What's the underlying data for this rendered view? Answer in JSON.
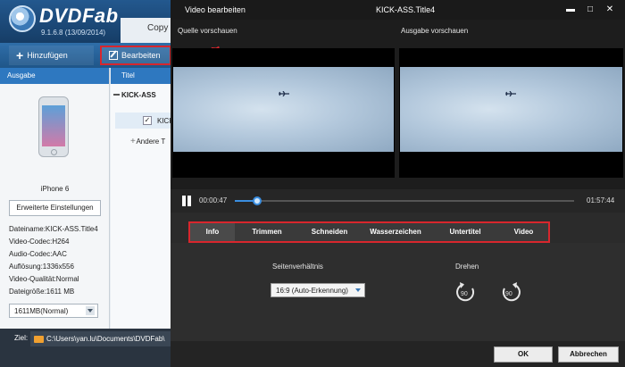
{
  "app": {
    "brand": "DVDFab",
    "version": "9.1.6.8 (13/09/2014)",
    "mode_tab": "Copy",
    "toolbar": {
      "add_label": "Hinzufügen",
      "edit_label": "Bearbeiten"
    },
    "left_panel": {
      "header": "Ausgabe",
      "device_name": "iPhone 6",
      "advanced_button": "Erweiterte Einstellungen",
      "info_lines": [
        "Dateiname:KICK-ASS.Title4",
        "Video-Codec:H264",
        "Audio-Codec:AAC",
        "Auflösung:1336x556",
        "Video-Qualität:Normal",
        "Dateigröße:1611 MB"
      ],
      "size_select_value": "1611MB(Normal)"
    },
    "title_list": {
      "header": "Titel",
      "main_row": "KICK-ASS",
      "sub_row": "KICK",
      "other_row": "Andere T"
    },
    "footer": {
      "dest_label": "Ziel:",
      "dest_path": "C:\\Users\\yan.lu\\Documents\\DVDFab\\"
    }
  },
  "dialog": {
    "title": "Video bearbeiten",
    "subtitle": "KICK-ASS.Title4",
    "source_preview_label": "Quelle vorschauen",
    "output_preview_label": "Ausgabe vorschauen",
    "transport": {
      "current_time": "00:00:47",
      "total_time": "01:57:44",
      "progress": 0.067
    },
    "tabs": [
      {
        "label": "Info",
        "active": true
      },
      {
        "label": "Trimmen",
        "active": false
      },
      {
        "label": "Schneiden",
        "active": false
      },
      {
        "label": "Wasserzeichen",
        "active": false
      },
      {
        "label": "Untertitel",
        "active": false
      },
      {
        "label": "Video",
        "active": false
      }
    ],
    "info": {
      "aspect_label": "Seitenverhältnis",
      "aspect_value": "16:9 (Auto-Erkennung)",
      "rotate_label": "Drehen",
      "rotate_left_value": "90",
      "rotate_right_value": "90"
    },
    "buttons": {
      "ok": "OK",
      "cancel": "Abbrechen"
    },
    "window_controls": [
      "minimize-icon",
      "maximize-icon",
      "close-icon"
    ]
  },
  "colors": {
    "highlight_red": "#d8262d",
    "accent_blue": "#2e78c0",
    "dialog_bg": "#2b2b2b"
  }
}
